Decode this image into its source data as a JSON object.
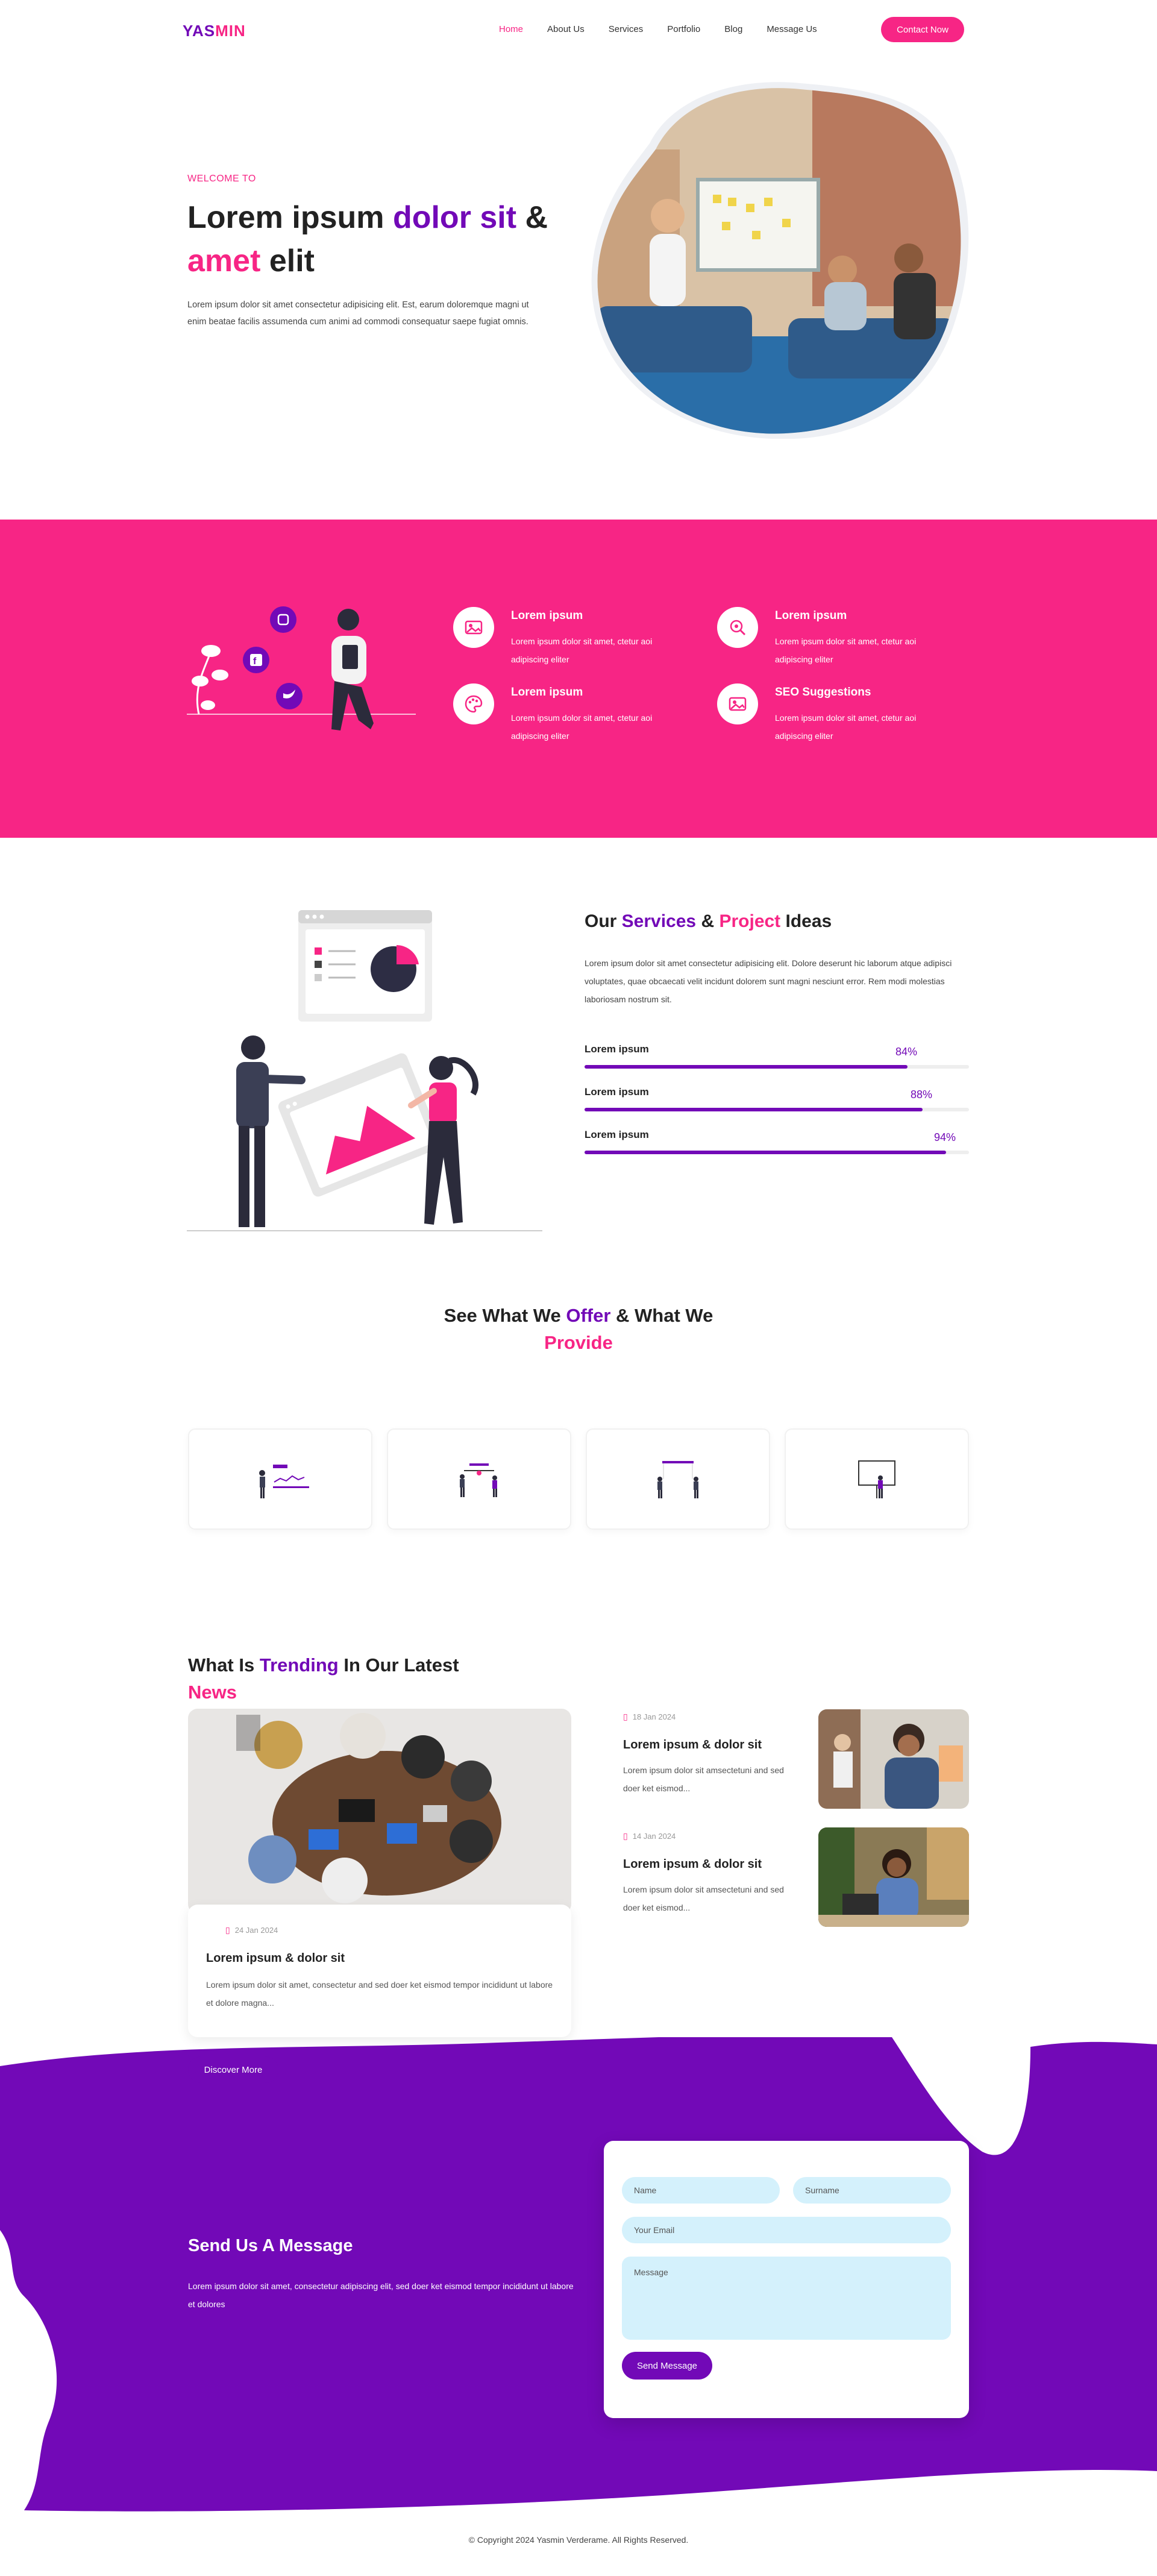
{
  "nav": {
    "logo_part1": "YAS",
    "logo_part2": "MIN",
    "items": [
      {
        "label": "Home",
        "active": true
      },
      {
        "label": "About Us"
      },
      {
        "label": "Services"
      },
      {
        "label": "Portfolio"
      },
      {
        "label": "Blog"
      },
      {
        "label": "Message Us"
      }
    ],
    "contact_button": "Contact Now"
  },
  "hero": {
    "welcome": "WELCOME TO",
    "title_a": "Lorem ipsum ",
    "title_b": "dolor sit",
    "title_c": " &",
    "title_d": "amet",
    "title_e": " elit",
    "description": "Lorem ipsum dolor sit amet consectetur adipisicing elit. Est, earum doloremque magni ut enim beatae facilis assumenda cum animi ad commodi consequatur saepe fugiat omnis."
  },
  "features": [
    {
      "title": "Lorem ipsum",
      "desc": "Lorem ipsum dolor sit amet, ctetur aoi adipiscing eliter",
      "icon": "image-icon"
    },
    {
      "title": "Lorem ipsum",
      "desc": "Lorem ipsum dolor sit amet, ctetur aoi adipiscing eliter",
      "icon": "search-icon"
    },
    {
      "title": "Lorem ipsum",
      "desc": "Lorem ipsum dolor sit amet, ctetur aoi adipiscing eliter",
      "icon": "palette-icon"
    },
    {
      "title": "SEO Suggestions",
      "desc": "Lorem ipsum dolor sit amet, ctetur aoi adipiscing eliter",
      "icon": "image-icon"
    }
  ],
  "services": {
    "title_a": "Our ",
    "title_b": "Services",
    "title_c": " & ",
    "title_d": "Project",
    "title_e": " Ideas",
    "description": "Lorem ipsum dolor sit amet consectetur adipisicing elit. Dolore deserunt hic laborum atque adipisci voluptates, quae obcaecati velit incidunt dolorem sunt magni nesciunt error. Rem modi molestias laboriosam nostrum sit.",
    "bars": [
      {
        "label": "Lorem ipsum",
        "value": 84,
        "value_text": "84%"
      },
      {
        "label": "Lorem ipsum",
        "value": 88,
        "value_text": "88%"
      },
      {
        "label": "Lorem ipsum",
        "value": 94,
        "value_text": "94%"
      }
    ]
  },
  "offer": {
    "title_a": "See What We ",
    "title_b": "Offer",
    "title_c": " & What We",
    "title_d": "Provide"
  },
  "news": {
    "title_a": "What Is ",
    "title_b": "Trending",
    "title_c": " In Our Latest",
    "title_d": "News",
    "main": {
      "date": "24 Jan 2024",
      "title": "Lorem ipsum & dolor sit",
      "desc": "Lorem ipsum dolor sit amet, consectetur and sed doer ket eismod tempor incididunt ut labore et dolore magna..."
    },
    "side": [
      {
        "date": "18 Jan 2024",
        "title": "Lorem ipsum & dolor sit",
        "desc": "Lorem ipsum dolor sit amsectetuni and sed doer ket eismod..."
      },
      {
        "date": "14 Jan 2024",
        "title": "Lorem ipsum & dolor sit",
        "desc": "Lorem ipsum dolor sit amsectetuni and sed doer ket eismod..."
      }
    ],
    "discover_button": "Discover More"
  },
  "message": {
    "title": "Send Us A Message",
    "desc": "Lorem ipsum dolor sit amet, consectetur adipiscing elit, sed doer ket eismod tempor incididunt ut labore et dolores",
    "name_placeholder": "Name",
    "surname_placeholder": "Surname",
    "email_placeholder": "Your Email",
    "message_placeholder": "Message",
    "send_button": "Send Message"
  },
  "footer": {
    "copyright": "© Copyright 2024 Yasmin Verderame. All Rights Reserved."
  },
  "colors": {
    "brand_pink": "#f72585",
    "brand_purple": "#7209b7",
    "field_bg": "#d4f1fc"
  }
}
